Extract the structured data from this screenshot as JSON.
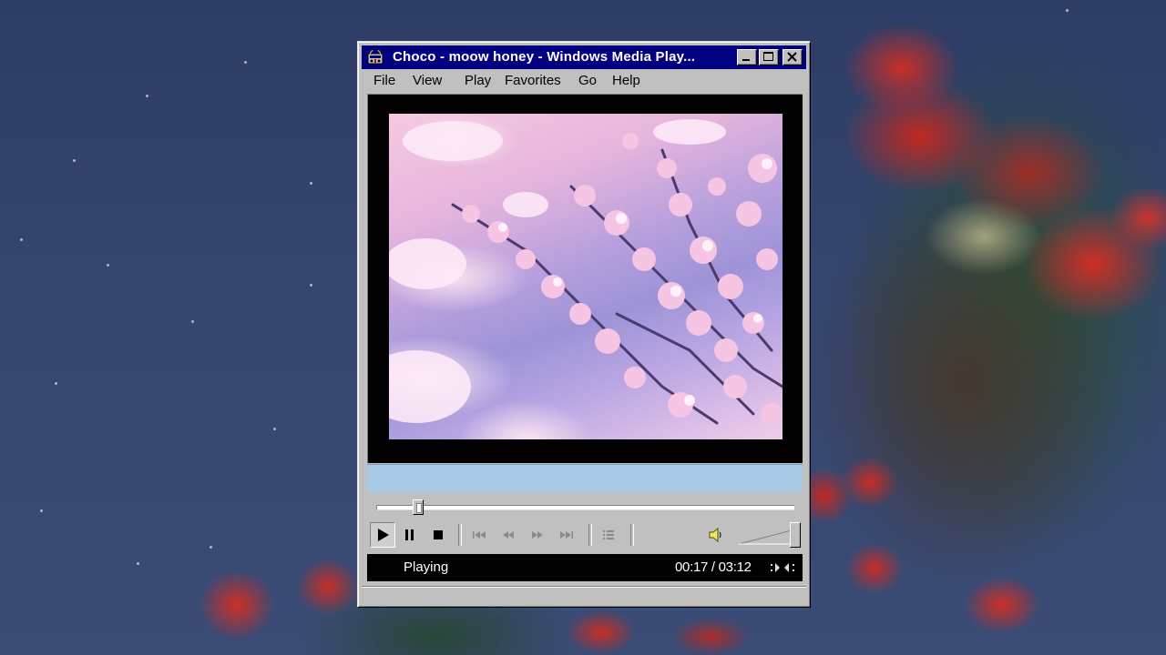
{
  "window": {
    "title": "Choco - moow honey - Windows Media Play...",
    "icon": "media-player-icon",
    "buttons": [
      "minimize-icon",
      "maximize-icon",
      "close-icon"
    ]
  },
  "menu": {
    "items": [
      "File",
      "View",
      "Play",
      "Favorites",
      "Go",
      "Help"
    ]
  },
  "player": {
    "status": "Playing",
    "time": "00:17 / 03:12",
    "seek_fraction": 0.089,
    "volume_fraction": 0.95,
    "controls": [
      "play-icon",
      "pause-icon",
      "stop-icon",
      "skip-back-icon",
      "rewind-icon",
      "fast-forward-icon",
      "skip-forward-icon",
      "playlist-icon",
      "speaker-icon"
    ]
  },
  "colors": {
    "titlebar": "#000080",
    "chrome": "#c0c0c0",
    "lyrics_bar": "#a7cbe6"
  }
}
